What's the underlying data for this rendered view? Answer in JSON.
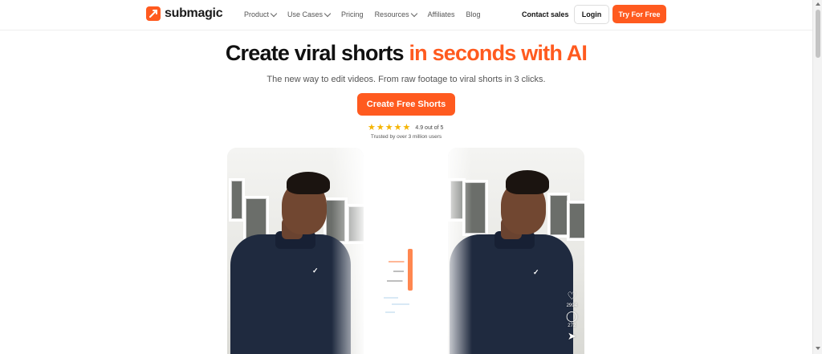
{
  "nav": {
    "logo_text": "submagic",
    "menu": [
      {
        "label": "Product",
        "has_dropdown": true
      },
      {
        "label": "Use Cases",
        "has_dropdown": true
      },
      {
        "label": "Pricing",
        "has_dropdown": false
      },
      {
        "label": "Resources",
        "has_dropdown": true
      },
      {
        "label": "Affiliates",
        "has_dropdown": false
      },
      {
        "label": "Blog",
        "has_dropdown": false
      }
    ],
    "contact_label": "Contact sales",
    "login_label": "Login",
    "try_label": "Try For Free"
  },
  "hero": {
    "title_main": "Create viral shorts",
    "title_accent": "in seconds with AI",
    "subtitle": "The new way to edit videos. From raw footage to viral shorts in 3 clicks.",
    "cta_label": "Create Free Shorts",
    "rating_stars": 5,
    "rating_text": "4.9 out of 5",
    "trusted_text": "Trusted by over 3 million users"
  },
  "video_right": {
    "likes_count": "2994",
    "comments_count": "272",
    "icons": [
      "heart-icon",
      "comment-icon",
      "share-icon"
    ]
  },
  "colors": {
    "accent": "#ff5a1f",
    "text": "#111111",
    "muted": "#555555"
  }
}
